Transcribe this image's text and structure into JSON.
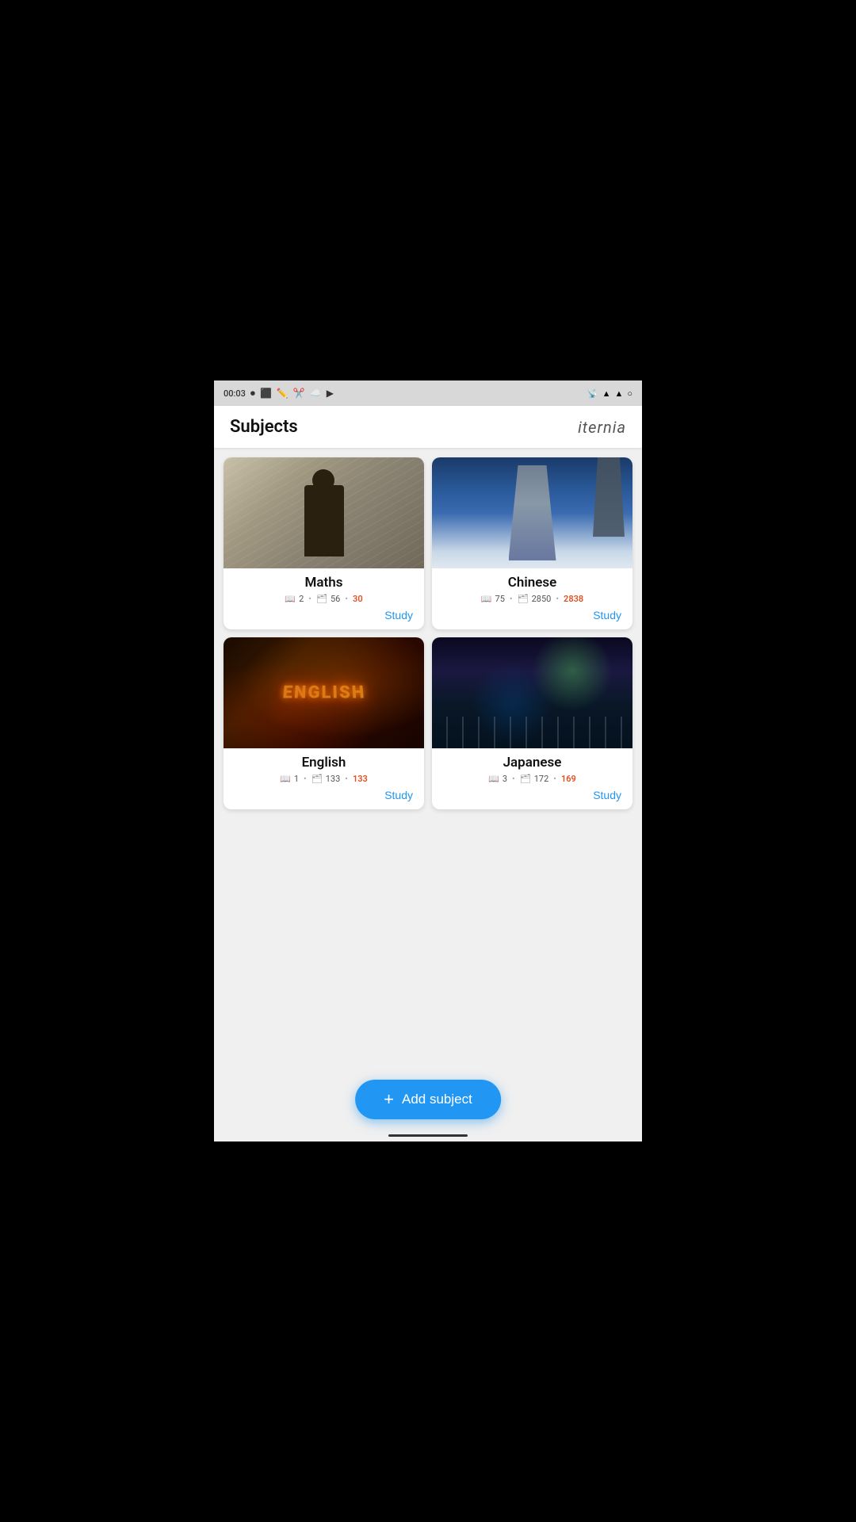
{
  "statusBar": {
    "time": "00:03",
    "icons": [
      "record",
      "screenshot",
      "pen",
      "scissors",
      "cloud",
      "play"
    ]
  },
  "header": {
    "title": "Subjects",
    "logo": "iternia"
  },
  "subjects": [
    {
      "id": "maths",
      "name": "Maths",
      "lessons": 2,
      "cards": 56,
      "due": 30,
      "studyLabel": "Study"
    },
    {
      "id": "chinese",
      "name": "Chinese",
      "lessons": 75,
      "cards": 2850,
      "due": 2838,
      "studyLabel": "Study"
    },
    {
      "id": "english",
      "name": "English",
      "lessons": 1,
      "cards": 133,
      "due": 133,
      "studyLabel": "Study"
    },
    {
      "id": "japanese",
      "name": "Japanese",
      "lessons": 3,
      "cards": 172,
      "due": 169,
      "studyLabel": "Study"
    }
  ],
  "fab": {
    "label": "Add subject",
    "plusSign": "+"
  },
  "icons": {
    "lessons": "📖",
    "cards": "🗂️"
  }
}
